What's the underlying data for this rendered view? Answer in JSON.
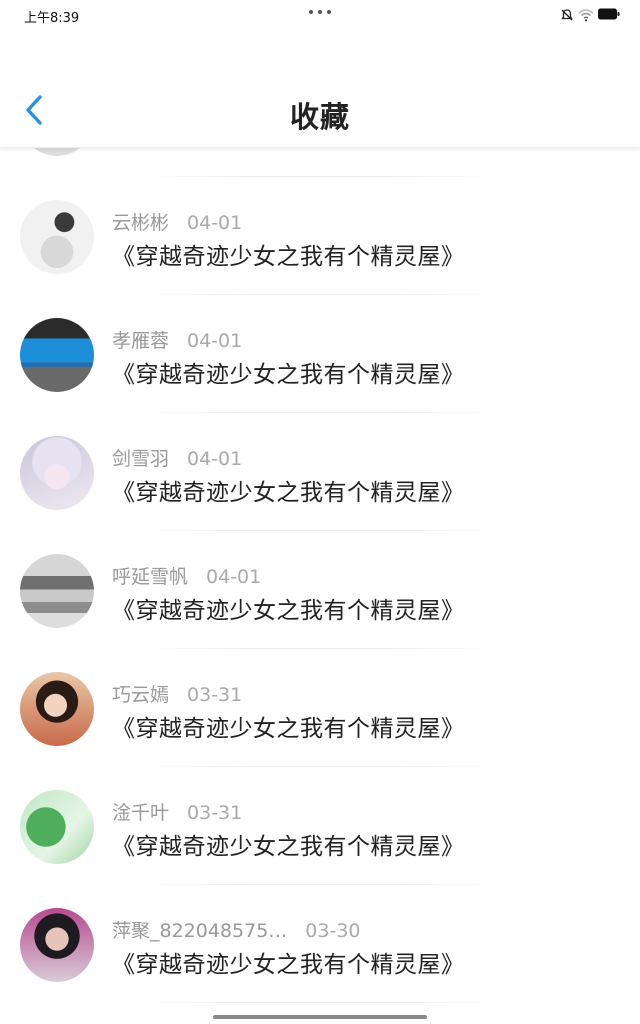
{
  "status_bar": {
    "time": "上午8:39"
  },
  "header": {
    "title": "收藏",
    "back_icon": "chevron-left-icon",
    "accent_color": "#2a8ee8"
  },
  "list": {
    "items": [
      {
        "user": "云彬彬",
        "date": "04-01",
        "title": "《穿越奇迹少女之我有个精灵屋》"
      },
      {
        "user": "孝雁蓉",
        "date": "04-01",
        "title": "《穿越奇迹少女之我有个精灵屋》"
      },
      {
        "user": "剑雪羽",
        "date": "04-01",
        "title": "《穿越奇迹少女之我有个精灵屋》"
      },
      {
        "user": "呼延雪帆",
        "date": "04-01",
        "title": "《穿越奇迹少女之我有个精灵屋》"
      },
      {
        "user": "巧云嫣",
        "date": "03-31",
        "title": "《穿越奇迹少女之我有个精灵屋》"
      },
      {
        "user": "淦千叶",
        "date": "03-31",
        "title": "《穿越奇迹少女之我有个精灵屋》"
      },
      {
        "user": "萍聚_822048575…",
        "date": "03-30",
        "title": "《穿越奇迹少女之我有个精灵屋》"
      }
    ]
  }
}
